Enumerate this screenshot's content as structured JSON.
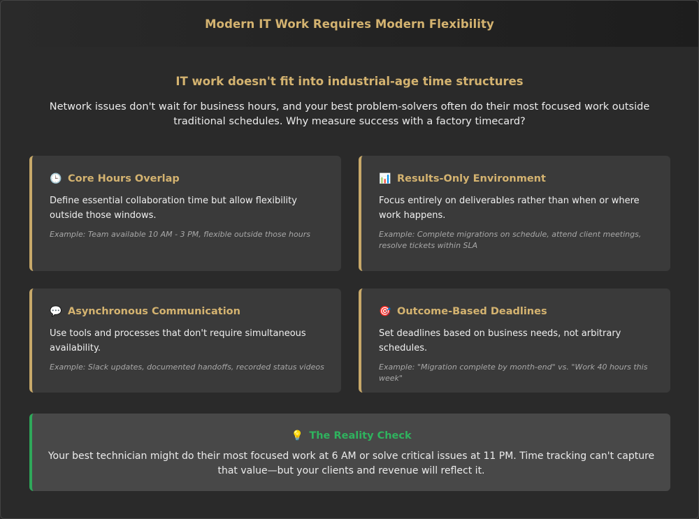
{
  "header": {
    "title": "Modern IT Work Requires Modern Flexibility"
  },
  "intro": {
    "heading": "IT work doesn't fit into industrial-age time structures",
    "text": "Network issues don't wait for business hours, and your best problem-solvers often do their most focused work outside traditional schedules. Why measure success with a factory timecard?"
  },
  "cards": [
    {
      "icon": "🕒",
      "icon_name": "clock-icon",
      "title": "Core Hours Overlap",
      "description": "Define essential collaboration time but allow flexibility outside those windows.",
      "example": "Example: Team available 10 AM - 3 PM, flexible outside those hours"
    },
    {
      "icon": "📊",
      "icon_name": "bar-chart-icon",
      "title": "Results-Only Environment",
      "description": "Focus entirely on deliverables rather than when or where work happens.",
      "example": "Example: Complete migrations on schedule, attend client meetings, resolve tickets within SLA"
    },
    {
      "icon": "💬",
      "icon_name": "speech-bubble-icon",
      "title": "Asynchronous Communication",
      "description": "Use tools and processes that don't require simultaneous availability.",
      "example": "Example: Slack updates, documented handoffs, recorded status videos"
    },
    {
      "icon": "🎯",
      "icon_name": "target-icon",
      "title": "Outcome-Based Deadlines",
      "description": "Set deadlines based on business needs, not arbitrary schedules.",
      "example": "Example: \"Migration complete by month-end\" vs. \"Work 40 hours this week\""
    }
  ],
  "reality_check": {
    "icon": "💡",
    "icon_name": "lightbulb-icon",
    "title": "The Reality Check",
    "text": "Your best technician might do their most focused work at 6 AM or solve critical issues at 11 PM. Time tracking can't capture that value—but your clients and revenue will reflect it."
  },
  "colors": {
    "accent_gold": "#d4b370",
    "accent_green": "#2fb35e",
    "background": "#2a2a2a",
    "card_background": "#3a3a3a"
  }
}
